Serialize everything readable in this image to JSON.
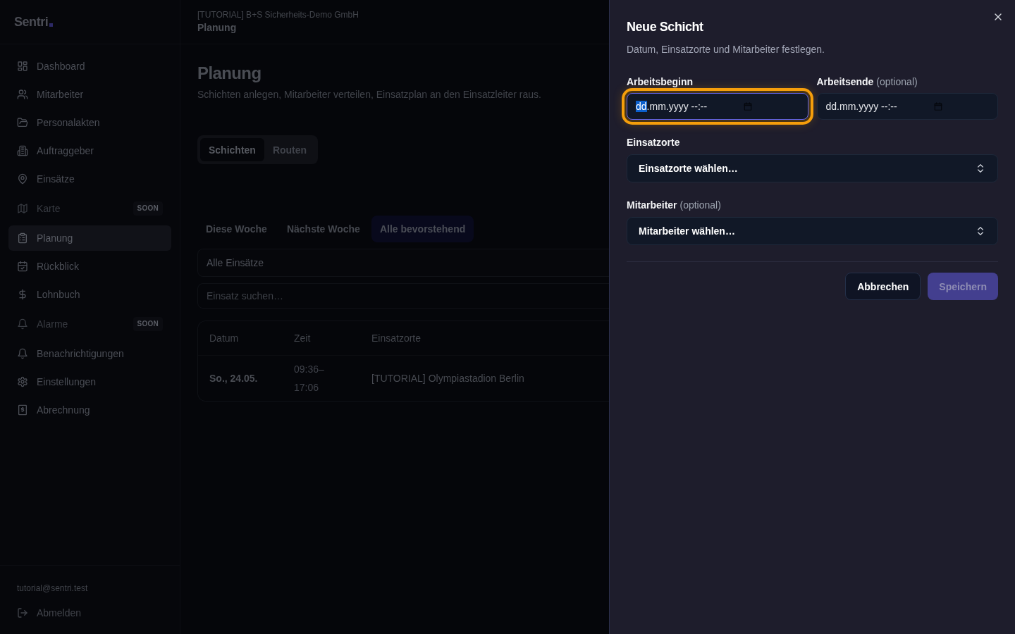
{
  "sidebar": {
    "logo": "Sentri",
    "items": [
      {
        "label": "Dashboard",
        "selected": false,
        "disabled": false
      },
      {
        "label": "Mitarbeiter",
        "selected": false,
        "disabled": false
      },
      {
        "label": "Personalakten",
        "selected": false,
        "disabled": false
      },
      {
        "label": "Auftraggeber",
        "selected": false,
        "disabled": false
      },
      {
        "label": "Einsätze",
        "selected": false,
        "disabled": false
      },
      {
        "label": "Karte",
        "selected": false,
        "disabled": true,
        "badge": "SOON"
      },
      {
        "label": "Planung",
        "selected": true,
        "disabled": false
      },
      {
        "label": "Rückblick",
        "selected": false,
        "disabled": false
      },
      {
        "label": "Lohnbuch",
        "selected": false,
        "disabled": false
      },
      {
        "label": "Alarme",
        "selected": false,
        "disabled": true,
        "badge": "SOON"
      },
      {
        "label": "Benachrichtigungen",
        "selected": false,
        "disabled": false
      },
      {
        "label": "Einstellungen",
        "selected": false,
        "disabled": false
      },
      {
        "label": "Abrechnung",
        "selected": false,
        "disabled": false
      }
    ],
    "user_email": "tutorial@sentri.test",
    "logout": "Abmelden"
  },
  "header": {
    "organization": "[TUTORIAL] B+S Sicherheits-Demo GmbH",
    "page": "Planung"
  },
  "page": {
    "title": "Planung",
    "subtitle": "Schichten anlegen, Mitarbeiter verteilen, Einsatzplan an den Einsatzleiter raus."
  },
  "view_tabs": [
    {
      "label": "Schichten",
      "selected": true
    },
    {
      "label": "Routen",
      "selected": false
    }
  ],
  "range_tabs": [
    {
      "label": "Diese Woche",
      "selected": false
    },
    {
      "label": "Nächste Woche",
      "selected": false
    },
    {
      "label": "Alle bevorstehend",
      "selected": true
    }
  ],
  "location_filter": {
    "value": "Alle Einsätze"
  },
  "search": {
    "placeholder": "Einsatz suchen…"
  },
  "table": {
    "columns": [
      "Datum",
      "Zeit",
      "Einsatzorte"
    ],
    "rows": [
      [
        "So., 24.05.",
        "09:36–17:06",
        "[TUTORIAL] Olympiastadion Berlin"
      ]
    ]
  },
  "drawer": {
    "title": "Neue Schicht",
    "description": "Datum, Einsatzorte und Mitarbeiter festlegen.",
    "fields": [
      {
        "kind": "datetime",
        "label": "Arbeitsbeginn",
        "focused": true,
        "segments": [
          {
            "text": "dd",
            "selected": true
          },
          {
            "text": ".mm.yyyy --:--",
            "selected": false
          }
        ]
      },
      {
        "kind": "datetime",
        "label": "Arbeitsende",
        "hint": "(optional)",
        "focused": false,
        "segments": [
          {
            "text": "dd",
            "selected": false
          },
          {
            "text": ".mm.yyyy --:--",
            "selected": false
          }
        ]
      },
      {
        "kind": "select",
        "label": "Einsatzorte",
        "focused": false,
        "value": "Einsatzorte wählen…"
      },
      {
        "kind": "select",
        "label": "Mitarbeiter",
        "hint": "(optional)",
        "focused": false,
        "value": "Mitarbeiter wählen…"
      }
    ],
    "buttons": [
      {
        "label": "Abbrechen",
        "kind": "secondary",
        "disabled": false
      },
      {
        "label": "Speichern",
        "kind": "primary",
        "disabled": true
      }
    ]
  }
}
